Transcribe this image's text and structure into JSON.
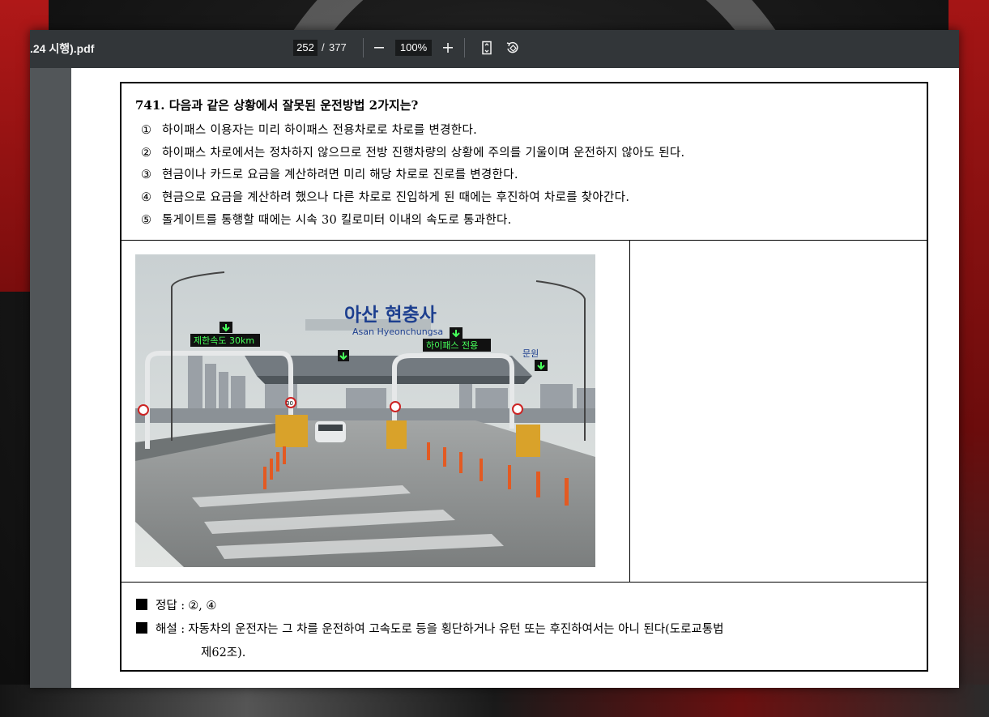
{
  "viewer": {
    "title": ".24 시행).pdf",
    "current_page": "252",
    "page_separator": "/",
    "total_pages": "377",
    "zoom": "100%",
    "icons": [
      "minus-icon",
      "plus-icon",
      "fit-page-icon",
      "rotate-icon"
    ]
  },
  "question": {
    "title": "741. 다음과 같은 상황에서 잘못된 운전방법 2가지는?",
    "options": [
      {
        "num": "①",
        "text": "하이패스 이용자는 미리 하이패스 전용차로로 차로를 변경한다."
      },
      {
        "num": "②",
        "text": "하이패스 차로에서는 정차하지 않으므로 전방 진행차량의 상황에 주의를 기울이며 운전하지 않아도 된다."
      },
      {
        "num": "③",
        "text": "현금이나 카드로 요금을 계산하려면 미리 해당 차로로 진로를 변경한다."
      },
      {
        "num": "④",
        "text": "현금으로 요금을 계산하려 했으나 다른 차로로 진입하게 된 때에는 후진하여 차로를 찾아간다."
      },
      {
        "num": "⑤",
        "text": "톨게이트를 통행할 때에는 시속 30 킬로미터 이내의 속도로 통과한다."
      }
    ]
  },
  "photo": {
    "plaza_name": "아산 현충사",
    "plaza_name_en": "Asan   Hyeonchungsa",
    "speed_sign": "제한속도 30km",
    "hipass_sign": "하이패스 전용",
    "speed_limit_marker": "30",
    "side_sign": "문원"
  },
  "answer": {
    "answer_label": "정답 :",
    "answer_value": "②, ④",
    "explain_label": "해설 :",
    "explain_line1": "자동차의 운전자는 그 차를 운전하여 고속도로 등을 횡단하거나 유턴 또는 후진하여서는 아니 된다(도로교통법",
    "explain_line2": "제62조)."
  }
}
